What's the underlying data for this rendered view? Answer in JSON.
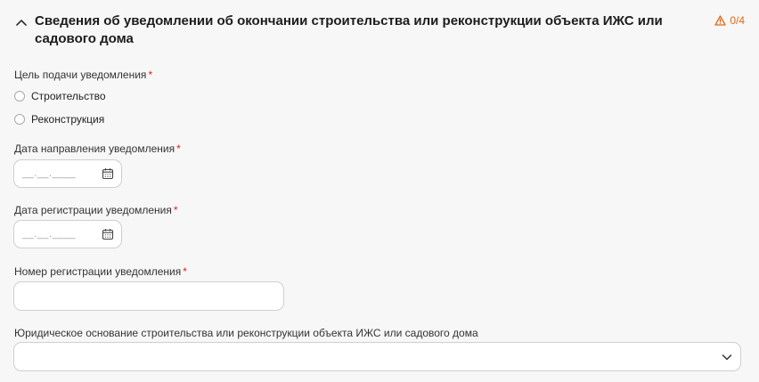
{
  "section": {
    "title": "Сведения об уведомлении об окончании строительства или реконструкции объекта ИЖС или садового дома",
    "counter": "0/4",
    "warning_color": "#e06a1a"
  },
  "purpose": {
    "label": "Цель подачи уведомления",
    "required_mark": "*",
    "options": [
      "Строительство",
      "Реконструкция"
    ],
    "selected": null
  },
  "send_date": {
    "label": "Дата направления уведомления",
    "required_mark": "*",
    "placeholder": "__.__.____",
    "value": ""
  },
  "registration_date": {
    "label": "Дата регистрации уведомления",
    "required_mark": "*",
    "placeholder": "__.__.____",
    "value": ""
  },
  "registration_number": {
    "label": "Номер регистрации уведомления",
    "required_mark": "*",
    "value": ""
  },
  "legal_basis": {
    "label": "Юридическое основание строительства или реконструкции объекта ИЖС или садового дома",
    "value": ""
  },
  "icons": {
    "collapse": "chevron-up-icon",
    "warning": "warning-triangle-icon",
    "calendar": "calendar-icon",
    "dropdown": "chevron-down-icon"
  }
}
